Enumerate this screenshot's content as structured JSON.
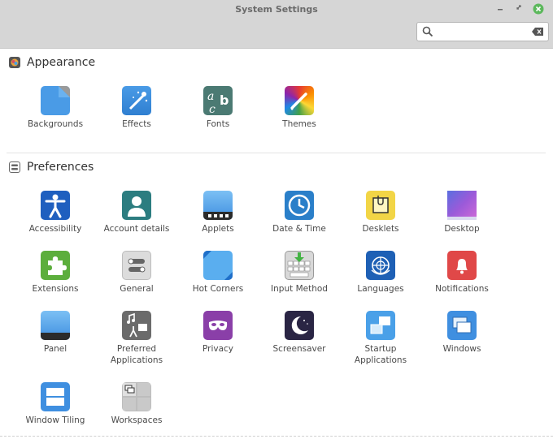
{
  "window": {
    "title": "System Settings"
  },
  "search": {
    "value": "",
    "placeholder": ""
  },
  "sections": [
    {
      "title": "Appearance",
      "items": [
        {
          "label": "Backgrounds",
          "icon": "backgrounds-icon"
        },
        {
          "label": "Effects",
          "icon": "effects-icon"
        },
        {
          "label": "Fonts",
          "icon": "fonts-icon"
        },
        {
          "label": "Themes",
          "icon": "themes-icon"
        }
      ]
    },
    {
      "title": "Preferences",
      "items": [
        {
          "label": "Accessibility",
          "icon": "accessibility-icon"
        },
        {
          "label": "Account details",
          "icon": "account-details-icon"
        },
        {
          "label": "Applets",
          "icon": "applets-icon"
        },
        {
          "label": "Date & Time",
          "icon": "clock-icon"
        },
        {
          "label": "Desklets",
          "icon": "desklets-icon"
        },
        {
          "label": "Desktop",
          "icon": "desktop-icon"
        },
        {
          "label": "Extensions",
          "icon": "puzzle-icon"
        },
        {
          "label": "General",
          "icon": "toggle-icon"
        },
        {
          "label": "Hot Corners",
          "icon": "hot-corners-icon"
        },
        {
          "label": "Input Method",
          "icon": "keyboard-icon"
        },
        {
          "label": "Languages",
          "icon": "globe-icon"
        },
        {
          "label": "Notifications",
          "icon": "bell-icon"
        },
        {
          "label": "Panel",
          "icon": "panel-icon"
        },
        {
          "label": "Preferred\nApplications",
          "label_line1": "Preferred",
          "label_line2": "Applications",
          "icon": "preferred-applications-icon"
        },
        {
          "label": "Privacy",
          "icon": "mask-icon"
        },
        {
          "label": "Screensaver",
          "icon": "moon-icon"
        },
        {
          "label": "Startup\nApplications",
          "label_line1": "Startup",
          "label_line2": "Applications",
          "icon": "startup-applications-icon"
        },
        {
          "label": "Windows",
          "icon": "windows-icon"
        },
        {
          "label": "Window Tiling",
          "icon": "window-tiling-icon"
        },
        {
          "label": "Workspaces",
          "icon": "workspaces-icon"
        }
      ]
    }
  ],
  "colors": {
    "titlebar": "#d6d6d6",
    "close_button": "#5cb85c"
  }
}
